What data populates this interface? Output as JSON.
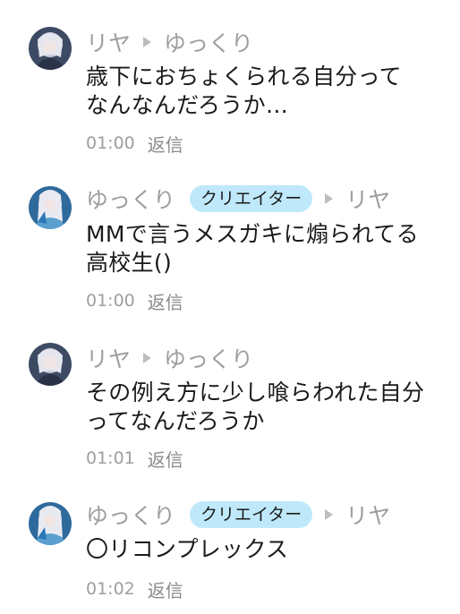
{
  "comments": [
    {
      "author": "リヤ",
      "creator_badge": "",
      "reply_to": "ゆっくり",
      "text_lines": [
        "歳下におちょくられる自分って",
        "なんなんだろうか…"
      ],
      "time": "01:00",
      "reply_label": "返信",
      "avatar": "riya-avatar"
    },
    {
      "author": "ゆっくり",
      "creator_badge": "クリエイター",
      "reply_to": "リヤ",
      "text_lines": [
        "MMで言うメスガキに煽られてる",
        "高校生()"
      ],
      "time": "01:00",
      "reply_label": "返信",
      "avatar": "yukkuri-avatar"
    },
    {
      "author": "リヤ",
      "creator_badge": "",
      "reply_to": "ゆっくり",
      "text_lines": [
        "その例え方に少し喰らわれた自分",
        "ってなんだろうか"
      ],
      "time": "01:01",
      "reply_label": "返信",
      "avatar": "riya-avatar"
    },
    {
      "author": "ゆっくり",
      "creator_badge": "クリエイター",
      "reply_to": "リヤ",
      "text_lines": [
        "〇リコンプレックス"
      ],
      "time": "01:02",
      "reply_label": "返信",
      "avatar": "yukkuri-avatar"
    }
  ],
  "colors": {
    "muted": "#9e9e9e",
    "badge_bg": "#bfe9fb",
    "text": "#1a1a1a"
  }
}
